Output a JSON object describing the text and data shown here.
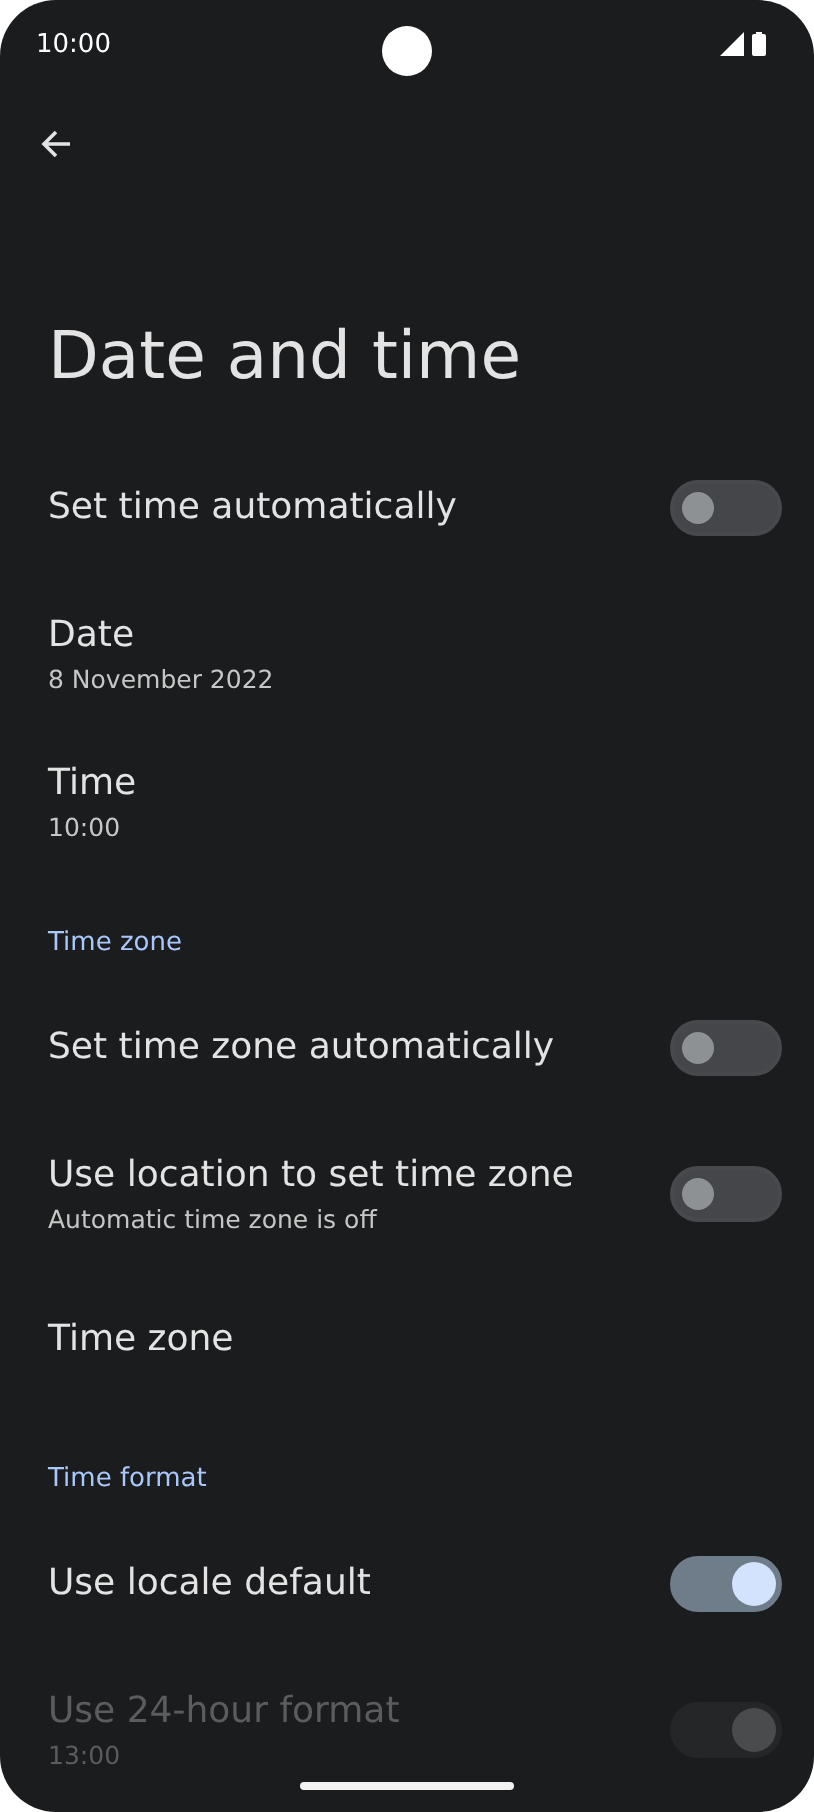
{
  "status_bar": {
    "time": "10:00"
  },
  "title": "Date and time",
  "items": [
    {
      "kind": "switch",
      "title": "Set time automatically",
      "on": false,
      "disabled": false
    },
    {
      "kind": "text",
      "title": "Date",
      "summary": "8 November 2022"
    },
    {
      "kind": "text",
      "title": "Time",
      "summary": "10:00"
    },
    {
      "kind": "header",
      "title": "Time zone"
    },
    {
      "kind": "switch",
      "title": "Set time zone automatically",
      "on": false,
      "disabled": false
    },
    {
      "kind": "switch",
      "title": "Use location to set time zone",
      "summary": "Automatic time zone is off",
      "on": false,
      "disabled": false
    },
    {
      "kind": "text",
      "title": "Time zone"
    },
    {
      "kind": "header",
      "title": "Time format"
    },
    {
      "kind": "switch",
      "title": "Use locale default",
      "on": true,
      "disabled": false
    },
    {
      "kind": "switch",
      "title": "Use 24-hour format",
      "summary": "13:00",
      "on": true,
      "disabled": true
    }
  ]
}
